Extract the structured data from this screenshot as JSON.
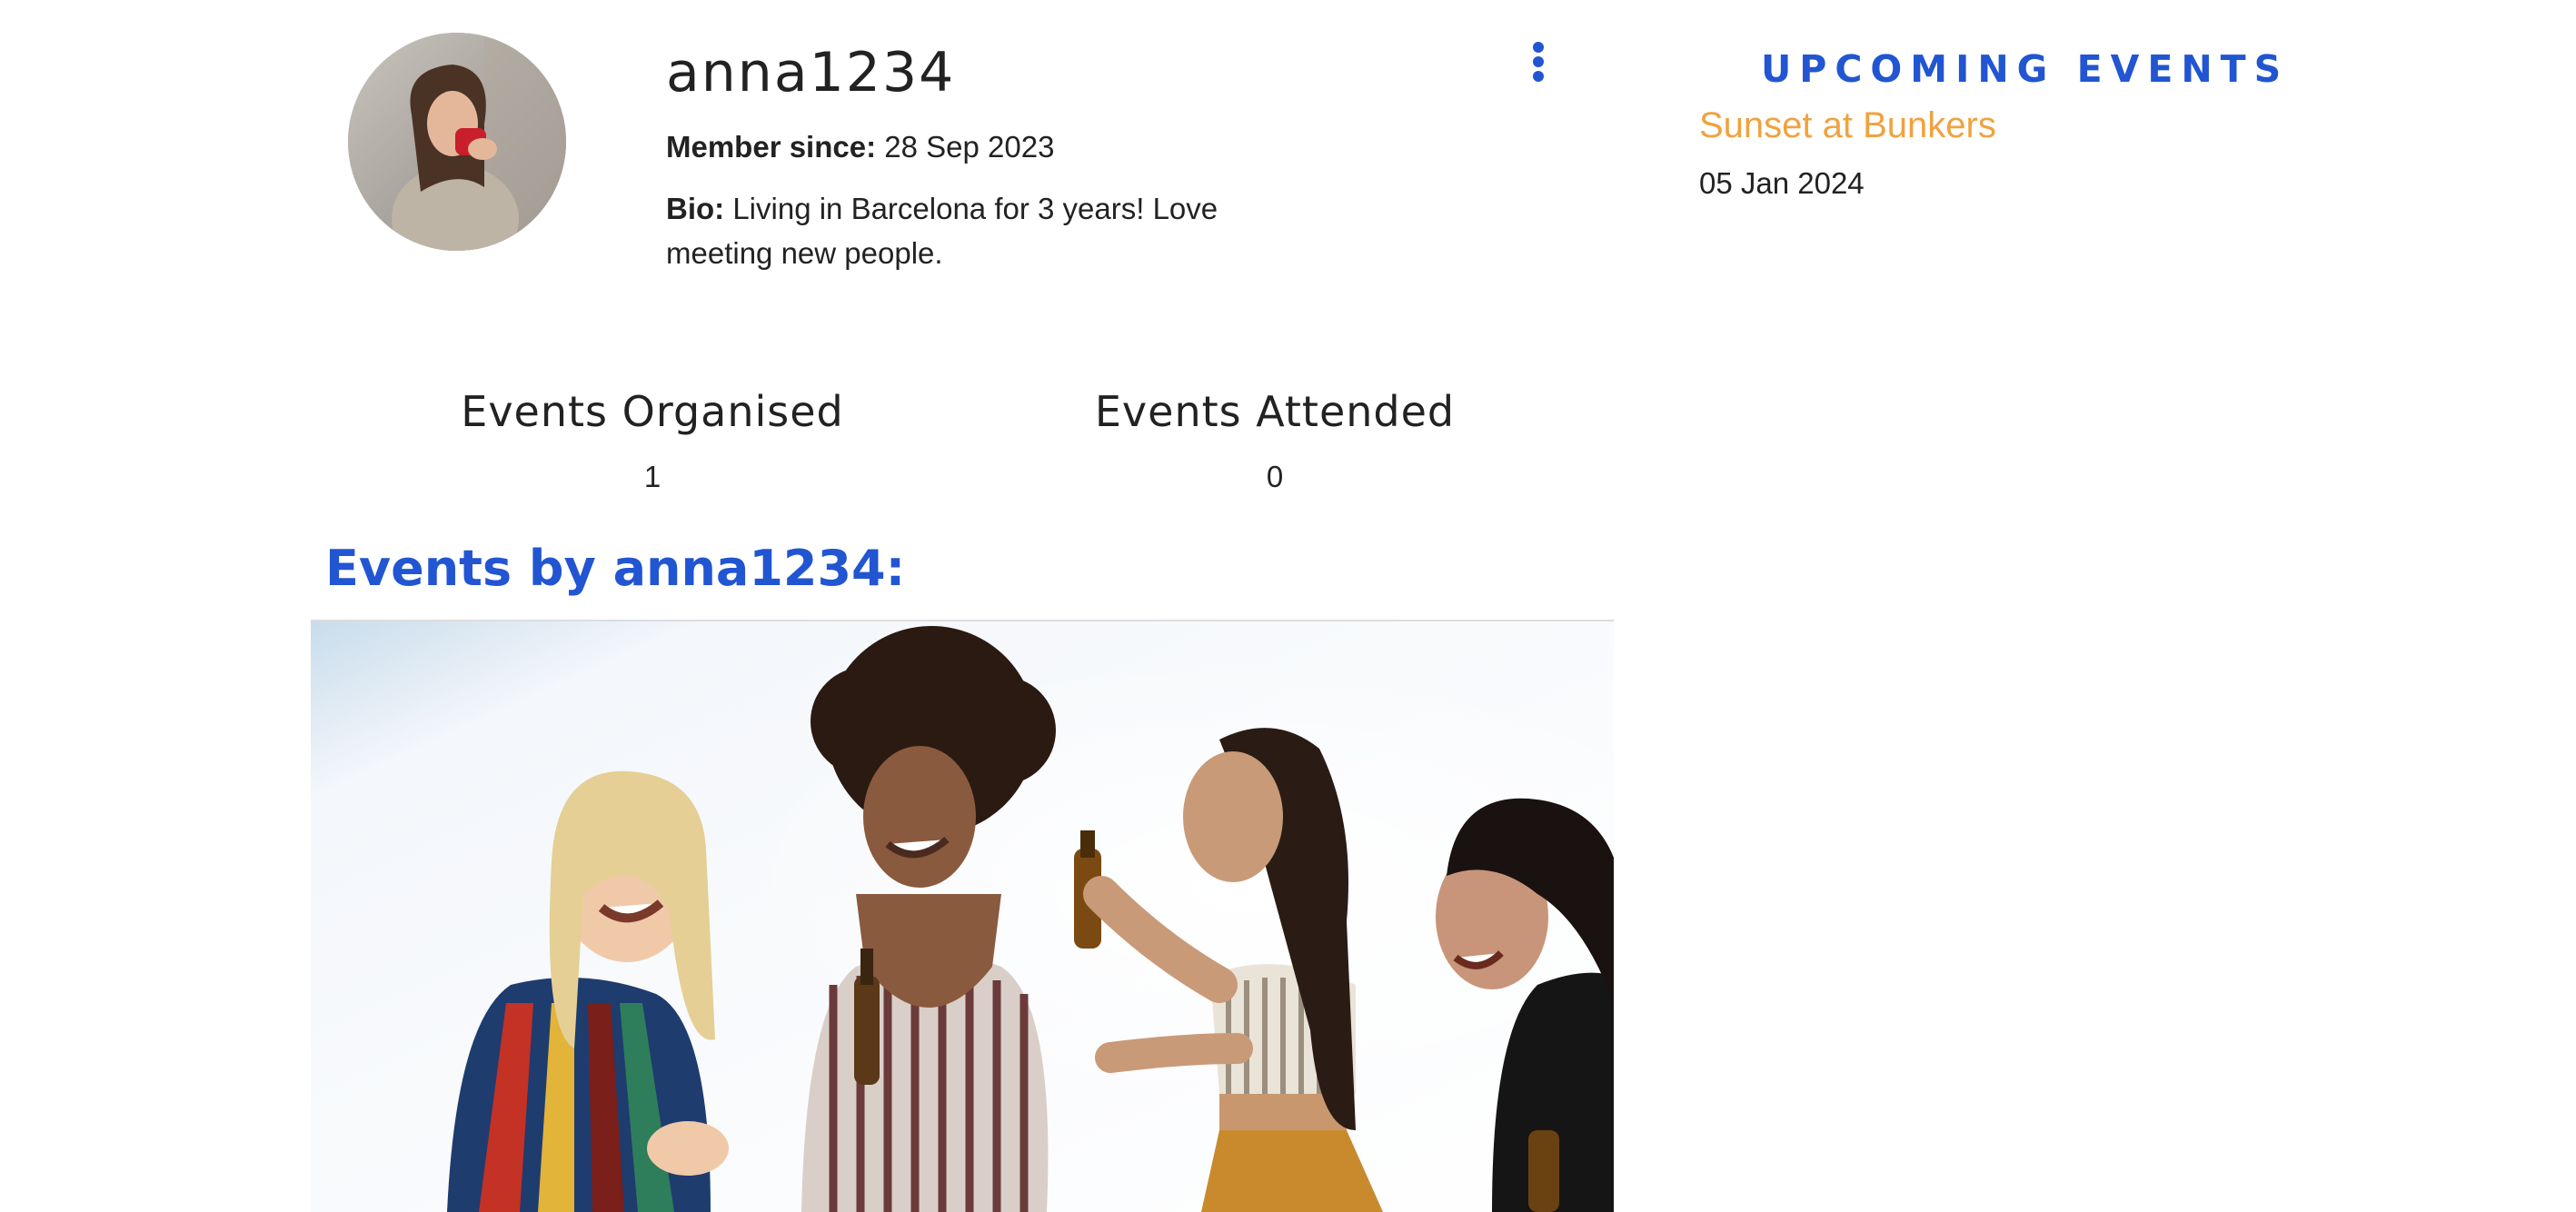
{
  "profile": {
    "username": "anna1234",
    "member_since_label": "Member since:",
    "member_since_value": " 28 Sep 2023",
    "bio_label": "Bio:",
    "bio_value": " Living in Barcelona for 3 years! Love meeting new people."
  },
  "menu": {
    "icon": "kebab-menu-icon"
  },
  "upcoming": {
    "heading": "UPCOMING EVENTS",
    "events": [
      {
        "title": "Sunset at Bunkers",
        "date": "05 Jan 2024"
      }
    ]
  },
  "stats": [
    {
      "label": "Events Organised",
      "value": "1"
    },
    {
      "label": "Events Attended",
      "value": "0"
    }
  ],
  "events_section": {
    "heading": "Events by anna1234:"
  },
  "colors": {
    "accent": "#2255d1",
    "link": "#f0a23f",
    "text": "#222222"
  }
}
